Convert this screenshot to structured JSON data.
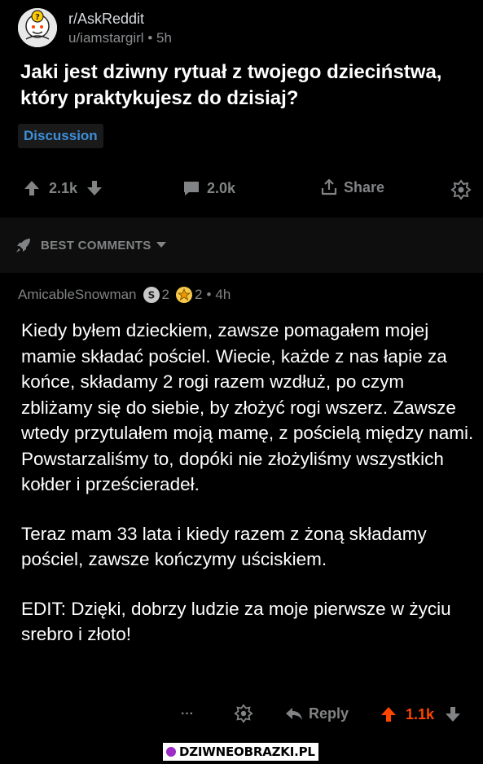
{
  "post": {
    "subreddit": "r/AskReddit",
    "author": "u/iamstargirl",
    "age": "5h",
    "title": "Jaki jest dziwny rytuał z twojego dzieciństwa, który praktykujesz do dzisiaj?",
    "flair": "Discussion",
    "upvotes": "2.1k",
    "comments": "2.0k",
    "share_label": "Share"
  },
  "sort": {
    "label": "BEST COMMENTS"
  },
  "comment": {
    "author": "AmicableSnowman",
    "silver_count": "2",
    "gold_count": "2",
    "age": "4h",
    "paragraphs": [
      "Kiedy byłem dzieckiem, zawsze pomagałem mojej mamie składać pościel. Wiecie, każde z nas łapie za końce, składamy 2 rogi razem wzdłuż, po czym zbliżamy się do siebie, by złożyć rogi wszerz. Zawsze wtedy przytulałem moją mamę, z pościelą między nami. Powstarzaliśmy to, dopóki nie złożyliśmy wszystkich kołder i prześcieradeł.",
      "Teraz mam 33 lata i kiedy razem z żoną składamy pościel, zawsze kończymy uściskiem.",
      "EDIT: Dzięki, dobrzy ludzie za moje pierwsze w życiu srebro i złoto!"
    ],
    "more_label": "···",
    "reply_label": "Reply",
    "score": "1.1k"
  },
  "watermark": "DZIWNEOBRAZKI.PL",
  "colors": {
    "flair": "#3d8fd8",
    "upvoted": "#ff4500",
    "background": "#000000"
  }
}
